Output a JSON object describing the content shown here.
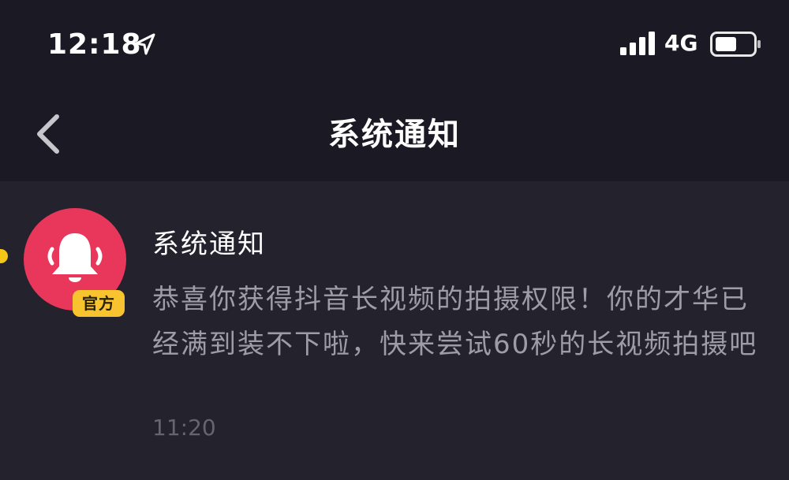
{
  "status_bar": {
    "time": "12:18",
    "network": "4G",
    "icons": [
      "location-arrow-icon",
      "signal-icon",
      "battery-icon"
    ]
  },
  "nav": {
    "title": "系统通知",
    "back_icon": "chevron-left-icon"
  },
  "notification": {
    "sender": "系统通知",
    "badge": "官方",
    "avatar_icon": "bell-icon",
    "body": "恭喜你获得抖音长视频的拍摄权限！你的才华已经满到装不下啦，快来尝试60秒的长视频拍摄吧",
    "time": "11:20",
    "unread": true
  },
  "colors": {
    "background": "#1b1a24",
    "list_background": "#23222d",
    "avatar": "#e8375a",
    "badge": "#f7c32e",
    "unread_dot": "#f5c518",
    "body_text": "#9e9ca8",
    "time_text": "#66646f"
  }
}
